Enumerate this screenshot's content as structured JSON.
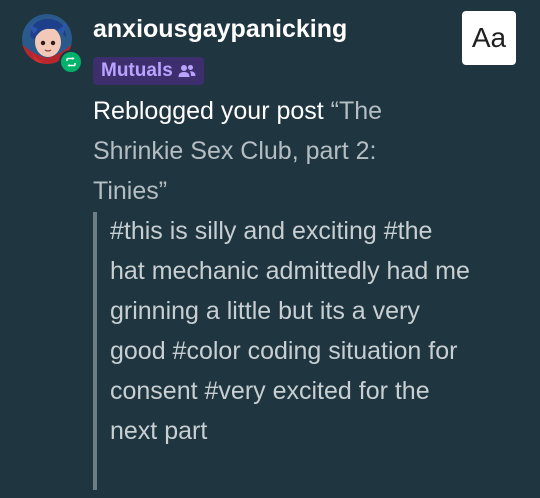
{
  "user": {
    "username": "anxiousgaypanicking",
    "badge": "Mutuals",
    "badge_icon": "people-icon",
    "avatar_icon": "avatar-icon",
    "reblog_icon": "reblog-icon"
  },
  "notification": {
    "prefix": "Reblogged your post ",
    "post_title": "“The Shrinkie Sex Club, part 2: Tinies”"
  },
  "tags_text": "#this is silly and exciting #the hat mechanic admittedly had me grinning a little but its a very good #color coding situation for consent #very excited for the next part",
  "controls": {
    "text_size_label": "Aa"
  },
  "colors": {
    "background": "#1f3540",
    "badge_background": "#3d2e6e",
    "badge_text": "#b9a3ff",
    "reblog_green": "#00b26b",
    "muted_text": "#b4bec2"
  }
}
